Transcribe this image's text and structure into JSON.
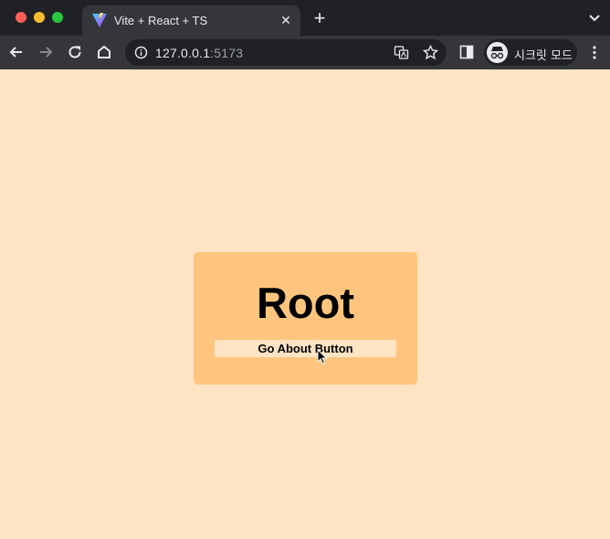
{
  "browser": {
    "tab": {
      "title": "Vite + React + TS",
      "favicon": "vite-logo-icon",
      "close_label": "✕"
    },
    "new_tab_label": "+",
    "address": {
      "host": "127.0.0.1",
      "port": ":5173"
    },
    "profile": {
      "label": "시크릿 모드",
      "icon": "incognito-icon"
    }
  },
  "page": {
    "background_color": "#ffe4c4",
    "card": {
      "background_color": "#ffc57f",
      "title": "Root",
      "button_label": "Go About Button"
    }
  }
}
